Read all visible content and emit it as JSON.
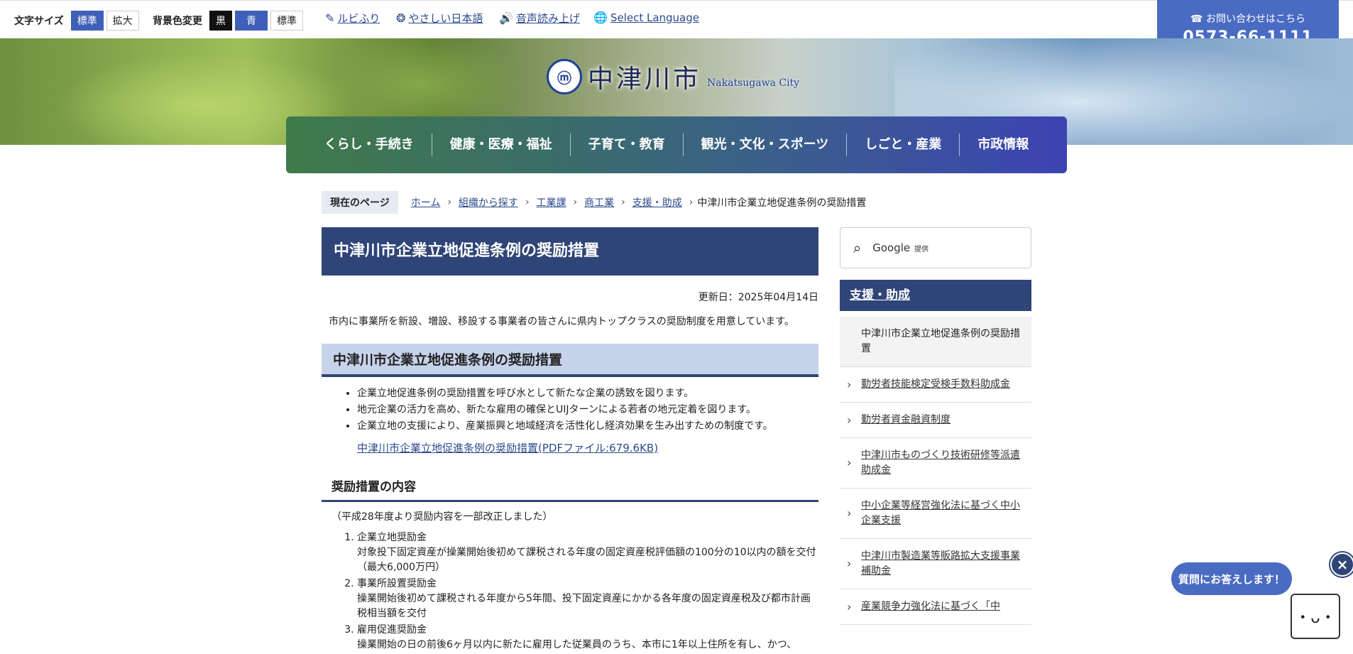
{
  "util": {
    "fontsize_label": "文字サイズ",
    "fontsize_standard": "標準",
    "fontsize_large": "拡大",
    "bgcolor_label": "背景色変更",
    "bg_black": "黒",
    "bg_blue": "青",
    "bg_standard": "標準",
    "ruby": "ルビふり",
    "easy_japanese": "やさしい日本語",
    "voice": "音声読み上げ",
    "language": "Select Language"
  },
  "contact": {
    "label": "お問い合わせはこちら",
    "phone": "0573-66-1111"
  },
  "logo": {
    "name": "中津川市",
    "sub": "Nakatsugawa City"
  },
  "gnav": [
    "くらし・手続き",
    "健康・医療・福祉",
    "子育て・教育",
    "観光・文化・スポーツ",
    "しごと・産業",
    "市政情報"
  ],
  "breadcrumb": {
    "current_label": "現在のページ",
    "items": [
      "ホーム",
      "組織から探す",
      "工業課",
      "商工業",
      "支援・助成"
    ],
    "current": "中津川市企業立地促進条例の奨励措置"
  },
  "main": {
    "title": "中津川市企業立地促進条例の奨励措置",
    "updated": "更新日：2025年04月14日",
    "intro": "市内に事業所を新設、増設、移設する事業者の皆さんに県内トップクラスの奨励制度を用意しています。",
    "h2": "中津川市企業立地促進条例の奨励措置",
    "bullets": [
      "企業立地促進条例の奨励措置を呼び水として新たな企業の誘致を図ります。",
      "地元企業の活力を高め、新たな雇用の確保とUIJターンによる若者の地元定着を図ります。",
      "企業立地の支援により、産業振興と地域経済を活性化し経済効果を生み出すための制度です。"
    ],
    "pdf_link": "中津川市企業立地促進条例の奨励措置(PDFファイル:679.6KB)",
    "h3": "奨励措置の内容",
    "note": "（平成28年度より奨励内容を一部改正しました）",
    "items": [
      {
        "title": "企業立地奨励金",
        "desc": "対象投下固定資産が操業開始後初めて課税される年度の固定資産税評価額の100分の10以内の額を交付（最大6,000万円）"
      },
      {
        "title": "事業所設置奨励金",
        "desc": "操業開始後初めて課税される年度から5年間、投下固定資産にかかる各年度の固定資産税及び都市計画税相当額を交付"
      },
      {
        "title": "雇用促進奨励金",
        "desc": "操業開始の日の前後6ヶ月以内に新たに雇用した従業員のうち、本市に1年以上住所を有し、かつ、"
      }
    ]
  },
  "sidebar": {
    "search_brand": "Google",
    "search_suffix": "提供",
    "heading": "支援・助成",
    "items": [
      "中津川市企業立地促進条例の奨励措置",
      "勤労者技能検定受検手数料助成金",
      "勤労者資金融資制度",
      "中津川市ものづくり技術研修等派遣助成金",
      "中小企業等経営強化法に基づく中小企業支援",
      "中津川市製造業等販路拡大支援事業補助金",
      "産業競争力強化法に基づく「中"
    ]
  },
  "chat": {
    "bubble": "質問にお答えします！",
    "close": "×"
  }
}
